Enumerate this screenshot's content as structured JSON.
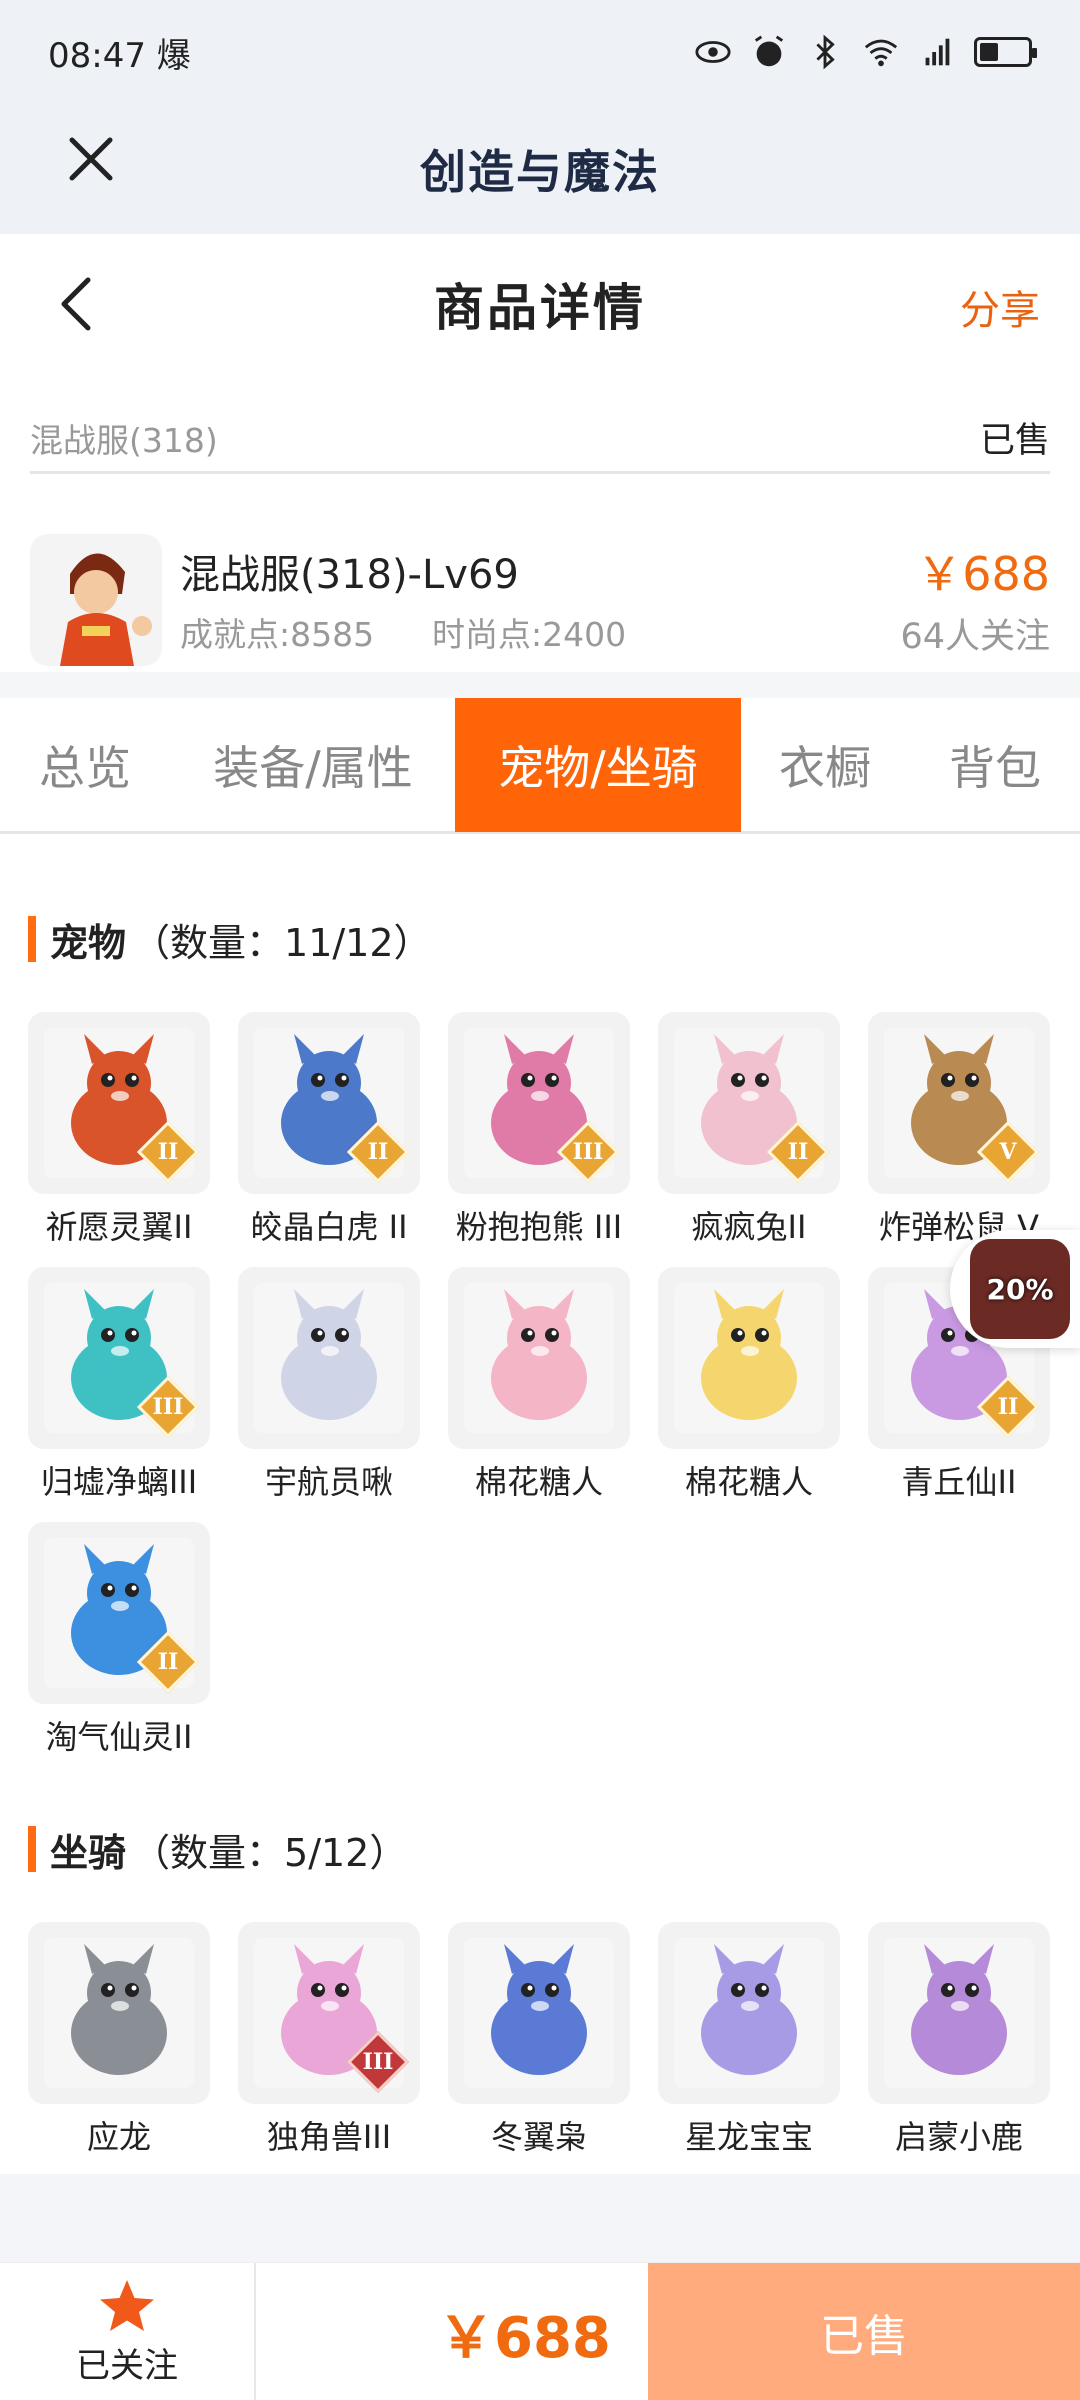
{
  "status_bar": {
    "time": "08:47",
    "flag": "爆"
  },
  "app": {
    "title": "创造与魔法"
  },
  "page": {
    "title": "商品详情",
    "share": "分享"
  },
  "listing": {
    "server": "混战服(318)",
    "status": "已售",
    "name": "混战服(318)-Lv69",
    "achievement": "成就点:8585",
    "fashion": "时尚点:2400",
    "price": "￥688",
    "followers": "64人关注"
  },
  "tabs": [
    "总览",
    "装备/属性",
    "宠物/坐骑",
    "衣橱",
    "背包"
  ],
  "active_tab": 2,
  "pets": {
    "title": "宠物",
    "count": "（数量：11/12）",
    "items": [
      {
        "name": "祈愿灵翼II",
        "rank": "II",
        "color": "#d9532b"
      },
      {
        "name": "皎晶白虎 II",
        "rank": "II",
        "color": "#4c79c9"
      },
      {
        "name": "粉抱抱熊 III",
        "rank": "III",
        "color": "#e07ba8"
      },
      {
        "name": "疯疯兔II",
        "rank": "II",
        "color": "#f1c1cf"
      },
      {
        "name": "炸弹松鼠 V",
        "rank": "V",
        "color": "#b98a52"
      },
      {
        "name": "归墟净螭III",
        "rank": "III",
        "color": "#3fc1c4"
      },
      {
        "name": "宇航员啾",
        "rank": "",
        "color": "#cfd4e6"
      },
      {
        "name": "棉花糖人",
        "rank": "",
        "color": "#f4b6c6"
      },
      {
        "name": "棉花糖人",
        "rank": "",
        "color": "#f5d66e"
      },
      {
        "name": "青丘仙II",
        "rank": "II",
        "color": "#c99ae2"
      },
      {
        "name": "淘气仙灵II",
        "rank": "II",
        "color": "#3d8fe0"
      }
    ]
  },
  "mounts": {
    "title": "坐骑",
    "count": "（数量：5/12）",
    "items": [
      {
        "name": "应龙",
        "rank": "",
        "color": "#8a8f96"
      },
      {
        "name": "独角兽III",
        "rank": "III",
        "color": "#e9a6d6"
      },
      {
        "name": "冬翼枭",
        "rank": "",
        "color": "#5b7ad6"
      },
      {
        "name": "星龙宝宝",
        "rank": "",
        "color": "#a89be6"
      },
      {
        "name": "启蒙小鹿",
        "rank": "",
        "color": "#b58ad8"
      }
    ]
  },
  "float_badge": {
    "text": "20%"
  },
  "bottom": {
    "follow": "已关注",
    "price": "￥688",
    "sold": "已售"
  }
}
